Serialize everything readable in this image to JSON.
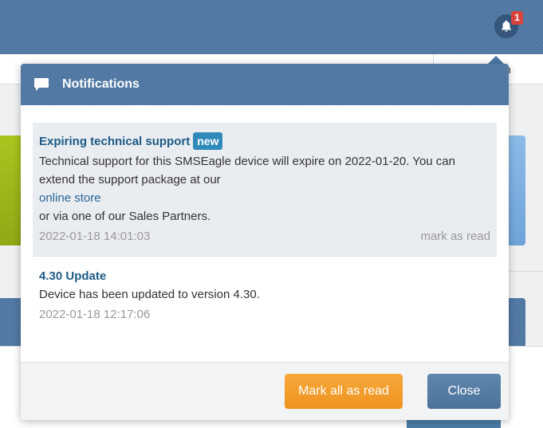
{
  "topbar": {
    "notification_count": "1"
  },
  "subbar": {
    "cell_text": "n"
  },
  "popover": {
    "title": "Notifications",
    "notifications": [
      {
        "title": "Expiring technical support",
        "badge": "new",
        "text": "Technical support for this SMSEagle device will expire on 2022-01-20. You can extend the support package at our",
        "link": "online store",
        "text_after": "or via one of our Sales Partners.",
        "timestamp": "2022-01-18 14:01:03",
        "action": "mark as read"
      },
      {
        "title": "4.30 Update",
        "text": "Device has been updated to version 4.30.",
        "timestamp": "2022-01-18 12:17:06"
      }
    ],
    "footer": {
      "mark_all_label": "Mark all as read",
      "close_label": "Close"
    }
  },
  "colors": {
    "header_blue": "#4f77a2",
    "link_blue": "#1d5a86",
    "badge_blue": "#2f8ab9",
    "orange": "#ef9220",
    "badge_red": "#d9413c"
  },
  "icons": {
    "bell": "bell-icon",
    "chat": "chat-icon"
  }
}
